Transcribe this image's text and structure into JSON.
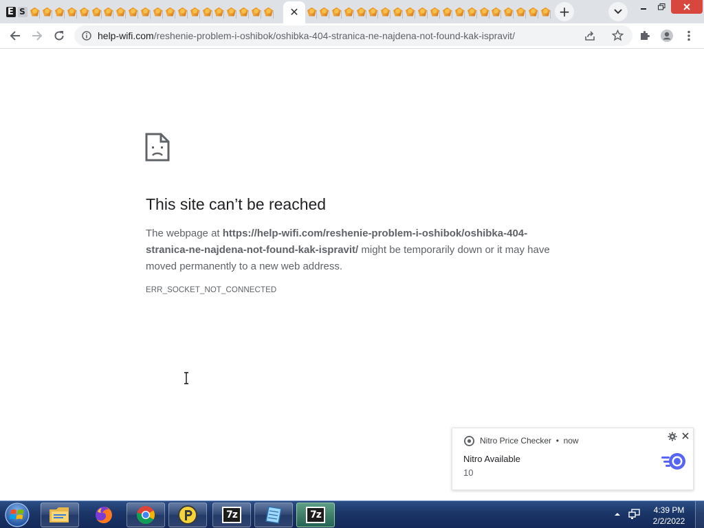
{
  "browser": {
    "active_tab_close": "✕",
    "new_tab_label": "+",
    "url_host": "help-wifi.com",
    "url_path": "/reshenie-problem-i-oshibok/oshibka-404-stranica-ne-najdena-not-found-kak-ispravit/"
  },
  "error_page": {
    "title": "This site can’t be reached",
    "body_prefix": "The webpage at ",
    "body_url": "https://help-wifi.com/reshenie-problem-i-oshibok/oshibka-404-stranica-ne-najdena-not-found-kak-ispravit/",
    "body_suffix": " might be temporarily down or it may have moved permanently to a new web address.",
    "error_code": "ERR_SOCKET_NOT_CONNECTED"
  },
  "notification": {
    "app_name": "Nitro Price Checker",
    "separator": "•",
    "time": "now",
    "title": "Nitro Available",
    "message": "10"
  },
  "taskbar": {
    "items": [
      "file-explorer-icon",
      "firefox-icon",
      "chrome-icon",
      "p-app-icon",
      "7zip-icon",
      "notepad-icon",
      "7zip-icon"
    ],
    "time": "4:39 PM",
    "date": "2/2/2022"
  },
  "colors": {
    "taskbar_top": "#2c4e86",
    "taskbar_bottom": "#14295a",
    "tabstrip": "#dee1e6",
    "close_red": "#d8473e"
  }
}
